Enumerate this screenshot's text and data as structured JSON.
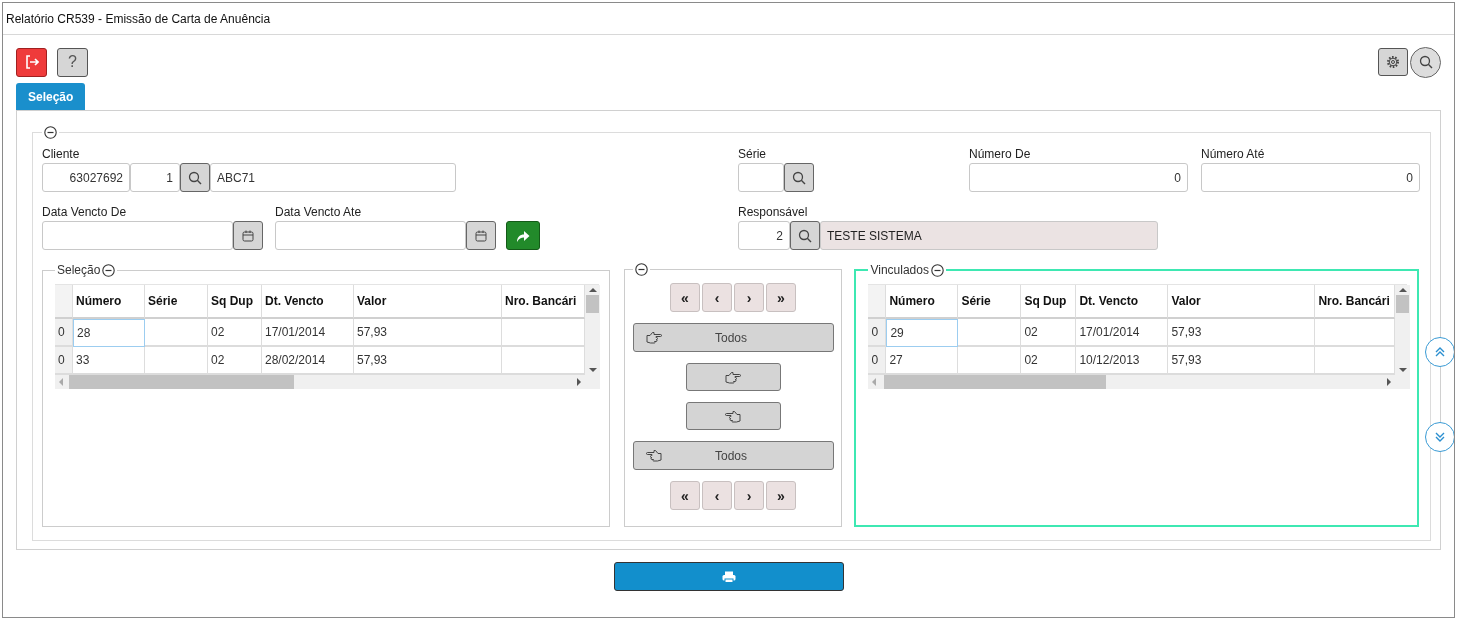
{
  "window": {
    "title": "Relatório CR539 - Emissão de Carta de Anuência"
  },
  "toolbar": {
    "help_label": "?"
  },
  "tabs": [
    {
      "label": "Seleção",
      "selected": true
    }
  ],
  "filters": {
    "cliente": {
      "label": "Cliente",
      "code": "63027692",
      "branch": "1",
      "name": "ABC71"
    },
    "serie": {
      "label": "Série"
    },
    "numero_de": {
      "label": "Número De",
      "value": "0"
    },
    "numero_ate": {
      "label": "Número Até",
      "value": "0"
    },
    "data_vencto_de": {
      "label": "Data Vencto De"
    },
    "data_vencto_ate": {
      "label": "Data Vencto Ate"
    },
    "responsavel": {
      "label": "Responsável",
      "code": "2",
      "name": "TESTE SISTEMA",
      "name_readonly": true
    }
  },
  "selecao": {
    "legend": "Seleção",
    "highlighted": false,
    "columns": [
      "Número",
      "Série",
      "Sq Dup",
      "Dt. Vencto",
      "Valor",
      "Nro. Bancári"
    ],
    "rows": [
      {
        "indicator": "0",
        "cells": [
          "28",
          null,
          "02",
          "17/01/2014",
          "57,93",
          null
        ],
        "focused": true
      },
      {
        "indicator": "0",
        "cells": [
          "33",
          null,
          "02",
          "28/02/2014",
          "57,93",
          null
        ],
        "focused": false
      }
    ]
  },
  "transfer": {
    "nav_top": [
      "«",
      "‹",
      "›",
      "»"
    ],
    "moves": [
      {
        "kind": "all_right",
        "label": "Todos"
      },
      {
        "kind": "one_right"
      },
      {
        "kind": "one_left"
      },
      {
        "kind": "all_left",
        "label": "Todos"
      }
    ],
    "nav_bottom": [
      "«",
      "‹",
      "›",
      "»"
    ]
  },
  "vinculados": {
    "legend": "Vinculados",
    "highlighted": true,
    "columns": [
      "Número",
      "Série",
      "Sq Dup",
      "Dt. Vencto",
      "Valor",
      "Nro. Bancári"
    ],
    "rows": [
      {
        "indicator": "0",
        "cells": [
          "29",
          null,
          "02",
          "17/01/2014",
          "57,93",
          null
        ],
        "focused": true
      },
      {
        "indicator": "0",
        "cells": [
          "27",
          null,
          "02",
          "10/12/2013",
          "57,93",
          null
        ],
        "focused": false
      }
    ]
  }
}
